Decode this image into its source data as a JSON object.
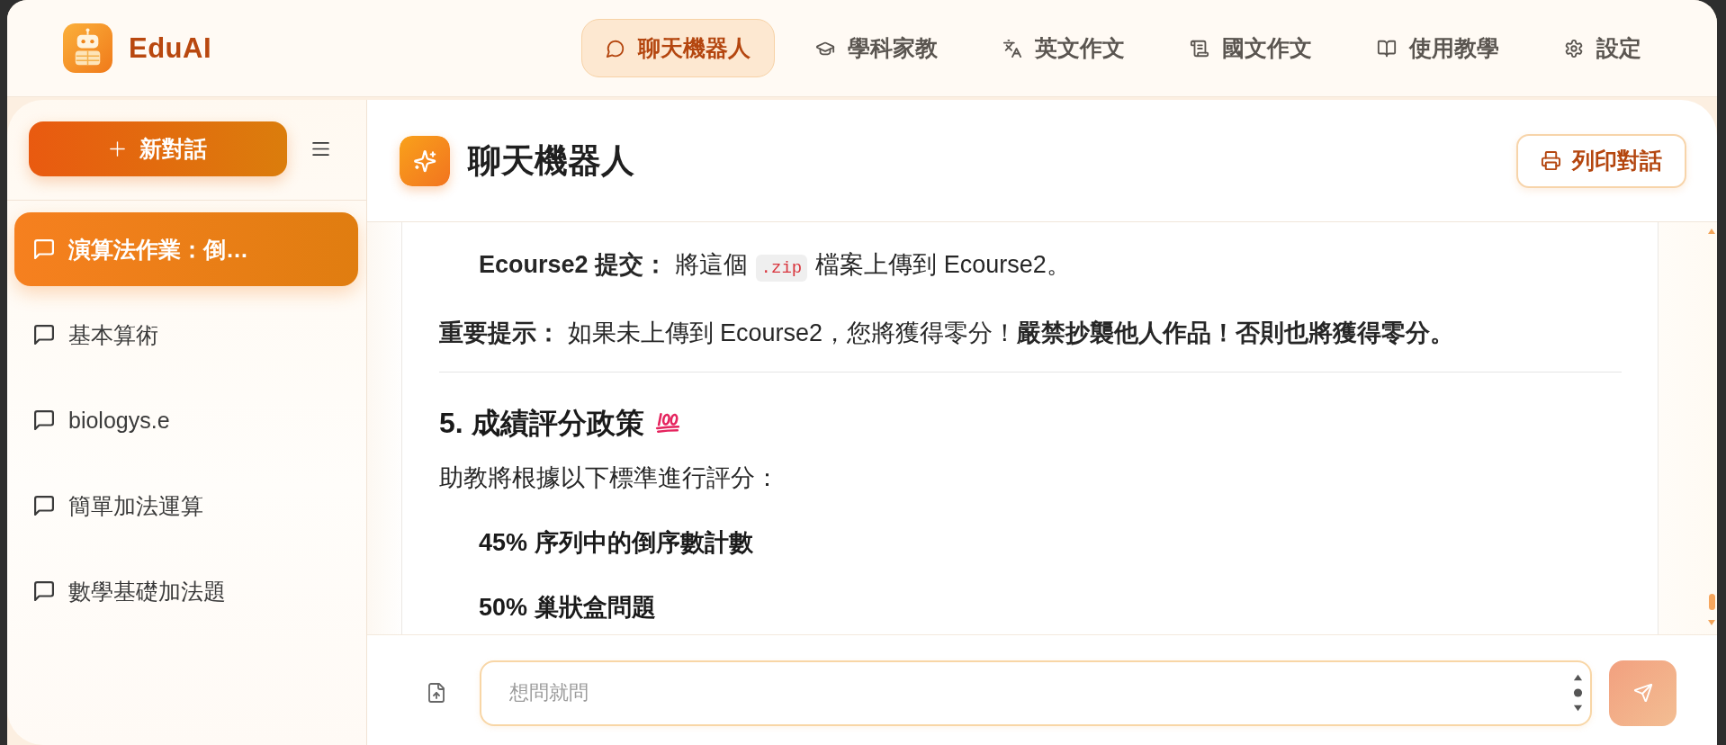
{
  "app": {
    "name": "EduAI"
  },
  "nav": [
    {
      "label": "聊天機器人",
      "selected": true
    },
    {
      "label": "學科家教",
      "selected": false
    },
    {
      "label": "英文作文",
      "selected": false
    },
    {
      "label": "國文作文",
      "selected": false
    },
    {
      "label": "使用教學",
      "selected": false
    },
    {
      "label": "設定",
      "selected": false
    }
  ],
  "sidebar": {
    "new_chat_button": "新對話",
    "conversations": [
      {
        "title": "演算法作業：倒…",
        "selected": true
      },
      {
        "title": "基本算術",
        "selected": false
      },
      {
        "title": "biologys.e",
        "selected": false
      },
      {
        "title": "簡單加法運算",
        "selected": false
      },
      {
        "title": "數學基礎加法題",
        "selected": false
      }
    ]
  },
  "chat": {
    "title": "聊天機器人",
    "print_button": "列印對話",
    "message": [
      {
        "kind": "list_item",
        "parts": [
          {
            "kind": "text",
            "text": "**Ecourse2 提交：** 將這個"
          },
          {
            "kind": "code",
            "text": ".zip"
          },
          {
            "kind": "text",
            "text": "檔案上傳到 Ecourse2。"
          }
        ]
      },
      {
        "kind": "paragraph",
        "parts": [
          {
            "kind": "text",
            "text": "**重要提示：** 如果未上傳到 Ecourse2，您將獲得零分！**嚴禁抄襲他人作品！否則也將獲得零分。**"
          }
        ]
      },
      {
        "kind": "rule"
      },
      {
        "kind": "heading",
        "text": "5. 成績評分政策"
      },
      {
        "kind": "paragraph",
        "parts": [
          {
            "kind": "text",
            "text": "助教將根據以下標準進行評分："
          }
        ]
      },
      {
        "kind": "list_item",
        "parts": [
          {
            "kind": "strong",
            "text": "45% 序列中的倒序數計數"
          }
        ]
      },
      {
        "kind": "list_item",
        "parts": [
          {
            "kind": "strong",
            "text": "50% 巢狀盒問題"
          }
        ]
      }
    ]
  },
  "composer": {
    "placeholder": "想問就問",
    "send_button": {
      "disabled": true
    }
  }
}
